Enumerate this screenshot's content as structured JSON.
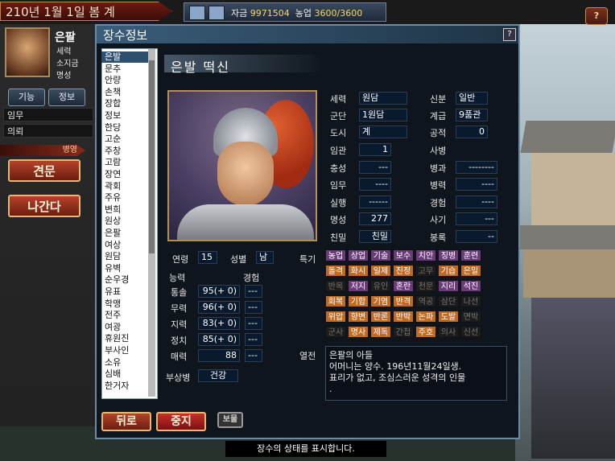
{
  "top": {
    "date": "210년 1월 1일 봄  계",
    "gold_label": "자금",
    "gold_value": "9971504",
    "farm_label": "농업",
    "farm_value": "3600/3600",
    "help": "?"
  },
  "left": {
    "name": "은팔",
    "line1": "세력",
    "line2": "소지금",
    "line3": "명성",
    "tab1": "기능",
    "tab2": "정보",
    "row1": "임무",
    "row2": "의뢰",
    "redbar": "병영",
    "btn1": "견문",
    "btn2": "나간다"
  },
  "dialog": {
    "title": "장수정보",
    "help": "?",
    "officer_name": "은발  떡신",
    "officers": [
      "은발",
      "문추",
      "안량",
      "손책",
      "장합",
      "정보",
      "한당",
      "고순",
      "주창",
      "고람",
      "장연",
      "곽회",
      "주유",
      "변희",
      "원상",
      "은팔",
      "여상",
      "원담",
      "유벽",
      "순우경",
      "유표",
      "학맹",
      "전주",
      "여광",
      "휴원진",
      "부사인",
      "소유",
      "심배",
      "한거자"
    ],
    "selected_index": 0,
    "stats": {
      "faction_l": "세력",
      "faction_v": "원담",
      "status_l": "신분",
      "status_v": "일반",
      "corps_l": "군단",
      "corps_v": "1원담",
      "rank_l": "계급",
      "rank_v": "9품관",
      "city_l": "도시",
      "city_v": "계",
      "merit_l": "공적",
      "merit_v": "0",
      "office_l": "임관",
      "office_v": "1",
      "loyalty_l": "충성",
      "loyalty_v": "---",
      "duty_l": "임무",
      "duty_v": "----",
      "exec_l": "실행",
      "exec_v": "------",
      "fame_l": "명성",
      "fame_v": "277",
      "close_l": "친밀",
      "close_v": "친밀",
      "death_l": "사병",
      "branch_l": "병과",
      "branch_v": "--------",
      "troops_l": "병력",
      "troops_v": "----",
      "exp_l": "경험",
      "exp_v": "----",
      "morale_l": "사기",
      "morale_v": "---",
      "salary_l": "봉록",
      "salary_v": "--"
    },
    "age_l": "연령",
    "age_v": "15",
    "sex_l": "성별",
    "sex_v": "남",
    "ability_l": "능력",
    "exp_col": "경험",
    "abilities": [
      {
        "name": "통솔",
        "value": "95(+ 0)",
        "exp": "---"
      },
      {
        "name": "무력",
        "value": "96(+ 0)",
        "exp": "---"
      },
      {
        "name": "지력",
        "value": "83(+ 0)",
        "exp": "---"
      },
      {
        "name": "정치",
        "value": "85(+ 0)",
        "exp": "---"
      },
      {
        "name": "매력",
        "value": "88",
        "exp": "---"
      }
    ],
    "injury_l": "부상병",
    "injury_v": "건강",
    "spec_l": "특기",
    "specs": [
      [
        "농업",
        "상업",
        "기술",
        "보수",
        "치안",
        "징병",
        "훈련"
      ],
      [
        "돌격",
        "화시",
        "일제",
        "진정",
        "고무",
        "기습",
        "은밀"
      ],
      [
        "반목",
        "저지",
        "유인",
        "혼란",
        "천문",
        "지리",
        "석진"
      ],
      [
        "회복",
        "기합",
        "기염",
        "반격",
        "역공",
        "삼단",
        "나선"
      ],
      [
        "위압",
        "향변",
        "반론",
        "반박",
        "논파",
        "도발",
        "면박"
      ],
      [
        "군사",
        "명사",
        "제독",
        "간첩",
        "주호",
        "의사",
        "신선"
      ]
    ],
    "bio_l": "열전",
    "bio": "은팔의 아들\n어머니는 양수. 196년11월24일생.\n표리가 없고, 조심스러운 성격의 인물\n.",
    "btn_back": "뒤로",
    "btn_stop": "중지",
    "btn_treasure": "보물"
  },
  "status": "장수의 상태를 표시합니다."
}
